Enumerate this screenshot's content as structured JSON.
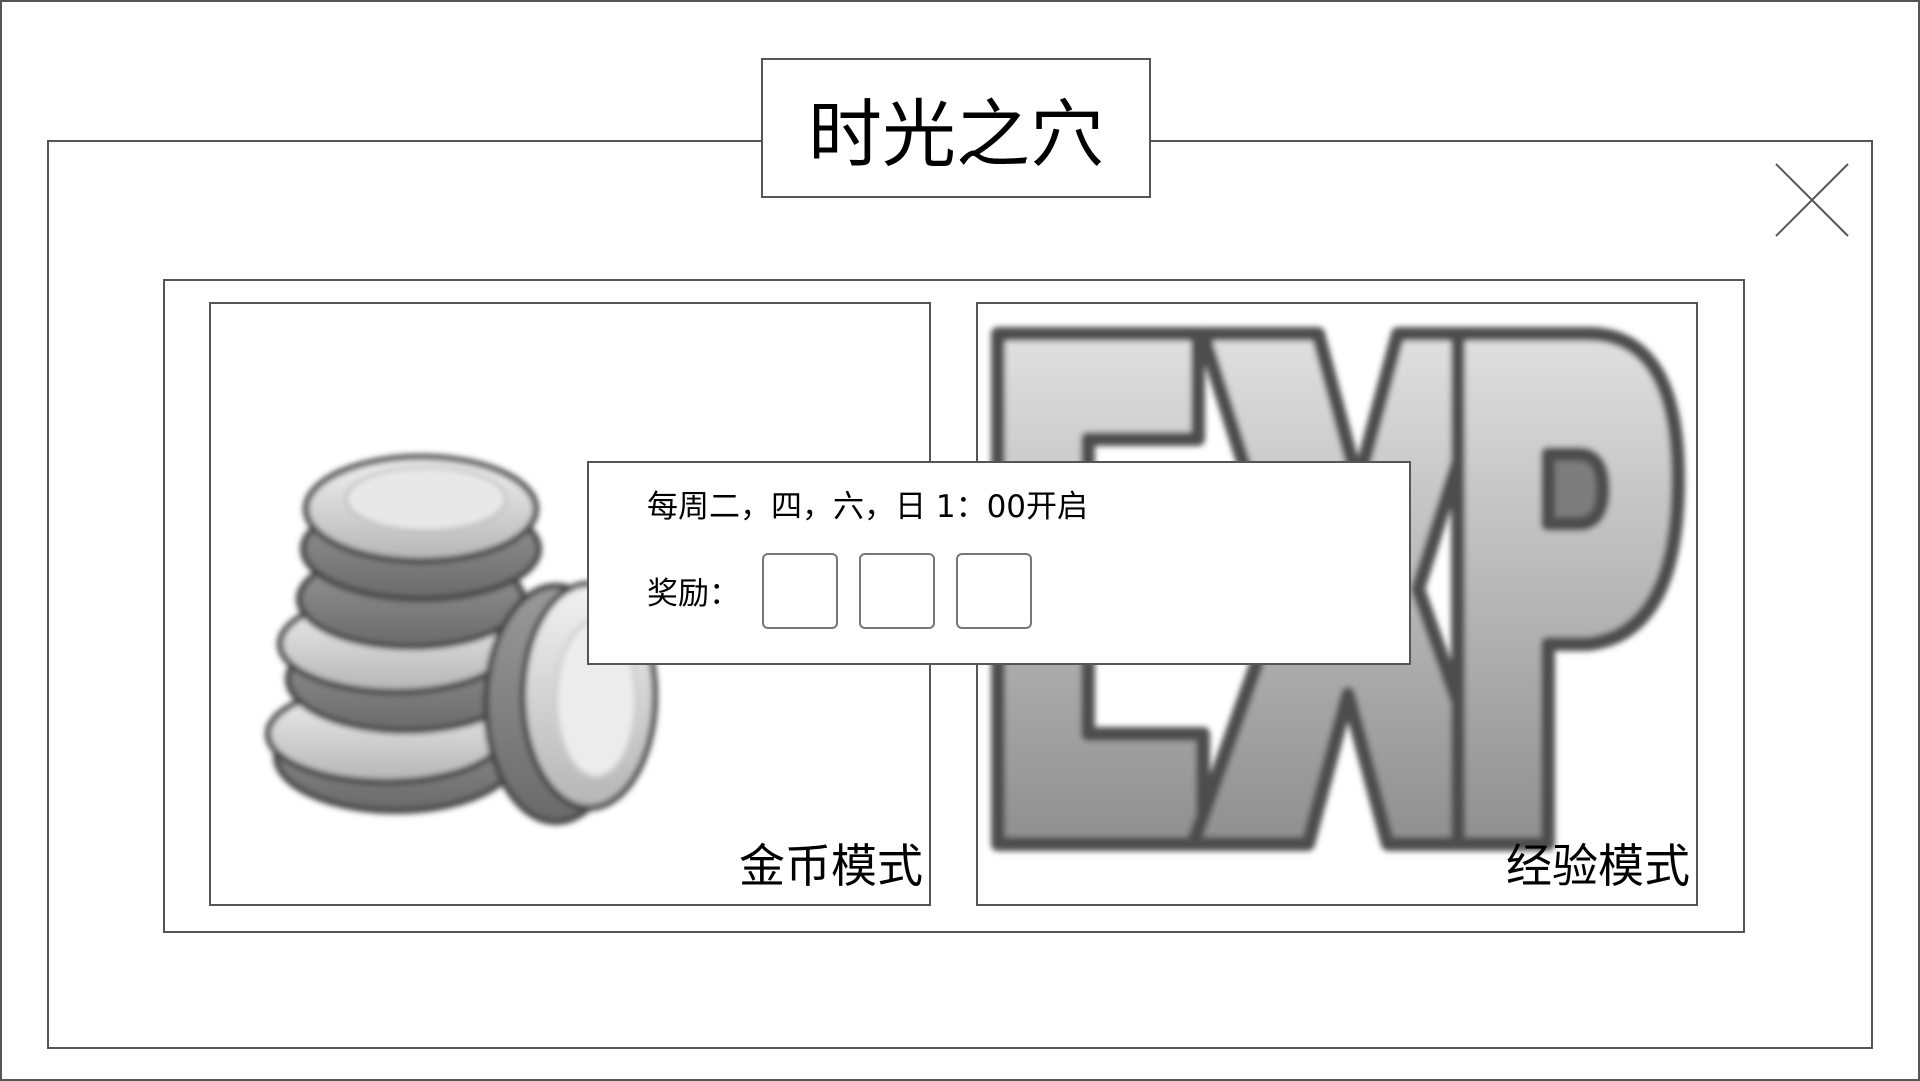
{
  "dialog": {
    "title": "时光之穴",
    "close_icon": "close-icon"
  },
  "modes": [
    {
      "label": "金币模式",
      "icon": "gold-coins-icon"
    },
    {
      "label": "经验模式",
      "icon": "exp-icon"
    }
  ],
  "popup": {
    "schedule": "每周二，四，六，日 1：00开启",
    "reward_label": "奖励：",
    "reward_slots": 3
  },
  "colors": {
    "border": "#555555",
    "background": "#ffffff",
    "text": "#000000"
  }
}
